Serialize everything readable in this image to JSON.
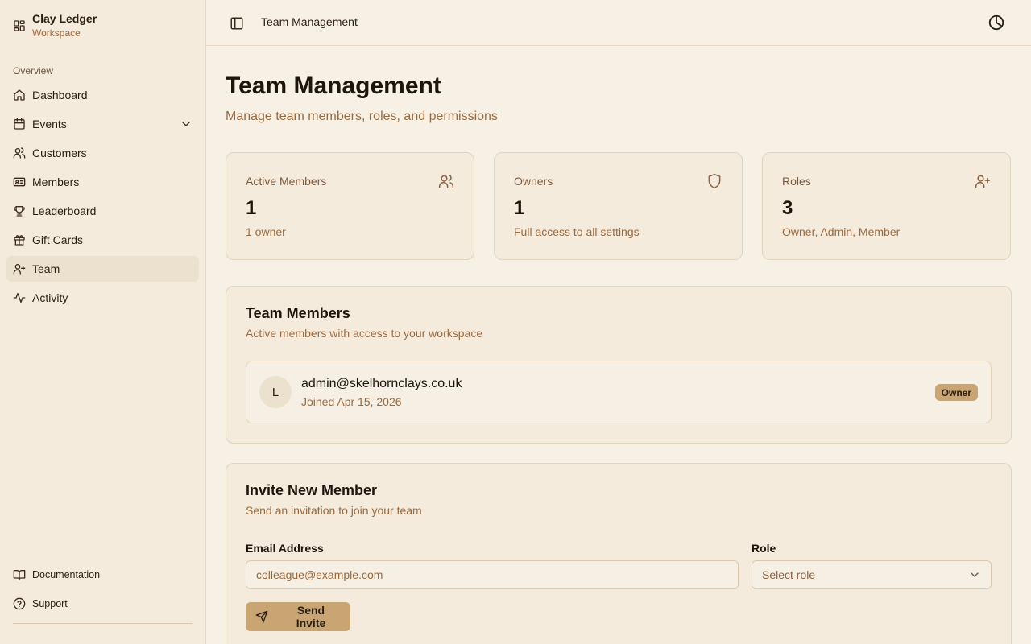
{
  "brand": {
    "name": "Clay Ledger",
    "subtitle": "Workspace"
  },
  "sidebar": {
    "section_label": "Overview",
    "items": [
      {
        "label": "Dashboard",
        "icon": "home-icon"
      },
      {
        "label": "Events",
        "icon": "calendar-icon",
        "expandable": true
      },
      {
        "label": "Customers",
        "icon": "users-icon"
      },
      {
        "label": "Members",
        "icon": "id-card-icon"
      },
      {
        "label": "Leaderboard",
        "icon": "trophy-icon"
      },
      {
        "label": "Gift Cards",
        "icon": "gift-icon"
      },
      {
        "label": "Team",
        "icon": "user-plus-icon",
        "active": true
      },
      {
        "label": "Activity",
        "icon": "activity-icon"
      }
    ],
    "footer": [
      {
        "label": "Documentation",
        "icon": "book-icon"
      },
      {
        "label": "Support",
        "icon": "help-circle-icon"
      }
    ]
  },
  "topbar": {
    "breadcrumb": "Team Management"
  },
  "page": {
    "title": "Team Management",
    "subtitle": "Manage team members, roles, and permissions"
  },
  "stats": [
    {
      "label": "Active Members",
      "value": "1",
      "note": "1 owner",
      "icon": "users-icon"
    },
    {
      "label": "Owners",
      "value": "1",
      "note": "Full access to all settings",
      "icon": "shield-icon"
    },
    {
      "label": "Roles",
      "value": "3",
      "note": "Owner, Admin, Member",
      "icon": "user-plus-icon"
    }
  ],
  "team": {
    "title": "Team Members",
    "subtitle": "Active members with access to your workspace",
    "members": [
      {
        "initial": "L",
        "email": "admin@skelhornclays.co.uk",
        "joined": "Joined Apr 15, 2026",
        "role": "Owner"
      }
    ]
  },
  "invite": {
    "title": "Invite New Member",
    "subtitle": "Send an invitation to join your team",
    "email_label": "Email Address",
    "email_placeholder": "colleague@example.com",
    "email_value": "",
    "role_label": "Role",
    "role_placeholder": "Select role",
    "submit_label": "Send Invite"
  },
  "colors": {
    "accent": "#c9a574",
    "background": "#f6f0e5",
    "muted_text": "#9a6a3f"
  }
}
